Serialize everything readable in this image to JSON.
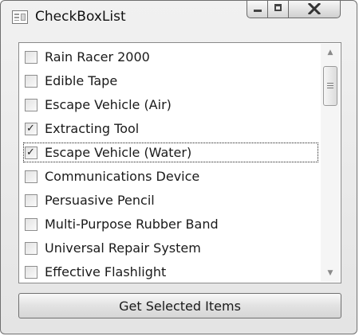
{
  "window": {
    "title": "CheckBoxList"
  },
  "items": [
    {
      "label": "Rain Racer 2000",
      "checked": false
    },
    {
      "label": "Edible Tape",
      "checked": false
    },
    {
      "label": "Escape Vehicle (Air)",
      "checked": false
    },
    {
      "label": "Extracting Tool",
      "checked": true
    },
    {
      "label": "Escape Vehicle (Water)",
      "checked": true,
      "focused": true
    },
    {
      "label": "Communications Device",
      "checked": false
    },
    {
      "label": "Persuasive Pencil",
      "checked": false
    },
    {
      "label": "Multi-Purpose Rubber Band",
      "checked": false
    },
    {
      "label": "Universal Repair System",
      "checked": false
    },
    {
      "label": "Effective Flashlight",
      "checked": false
    }
  ],
  "button": {
    "label": "Get Selected Items"
  },
  "icons": {
    "check": "check-icon",
    "scroll_up": "scroll-up-icon",
    "scroll_down": "scroll-down-icon"
  }
}
